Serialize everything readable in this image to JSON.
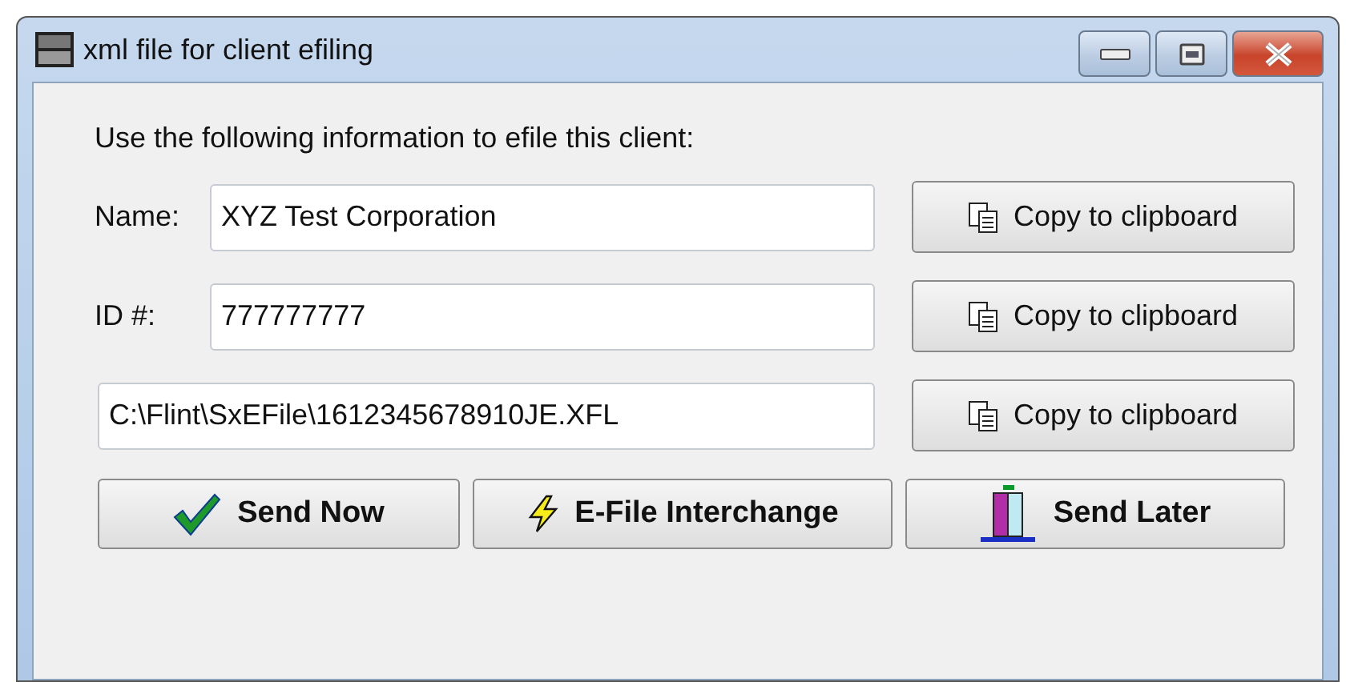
{
  "window": {
    "title": "xml file for client efiling"
  },
  "instruction": "Use the following information to efile this client:",
  "fields": [
    {
      "label": "Name:",
      "value": "XYZ Test Corporation",
      "copy": "Copy to clipboard"
    },
    {
      "label": "ID #:",
      "value": "777777777",
      "copy": "Copy to clipboard"
    },
    {
      "value": "C:\\Flint\\SxEFile\\1612345678910JE.XFL",
      "copy": "Copy to clipboard"
    }
  ],
  "buttons": [
    {
      "kind": "check",
      "label": "Send Now"
    },
    {
      "kind": "bolt",
      "label": "E-File Interchange"
    },
    {
      "kind": "later",
      "label": "Send Later"
    }
  ]
}
